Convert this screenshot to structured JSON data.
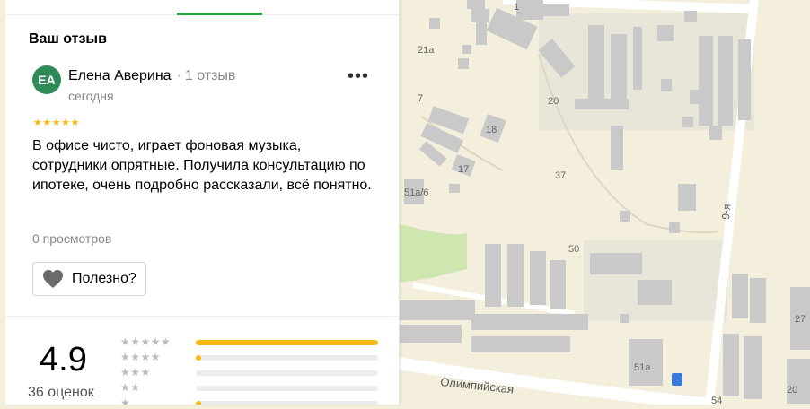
{
  "review": {
    "section_title": "Ваш отзыв",
    "avatar_initials": "ЕА",
    "author_name": "Елена Аверина",
    "separator": "·",
    "author_reviews": "1 отзыв",
    "date": "сегодня",
    "menu_label": "•••",
    "stars": "★★★★★",
    "text": "В офисе чисто, играет фоновая музыка, сотрудники опрятные. Получила консультацию по ипотеке, очень подробно рассказали, всё понятно.",
    "views": "0 просмотров",
    "useful_label": "Полезно?"
  },
  "rating": {
    "score": "4.9",
    "total": "36 оценок",
    "rows": [
      {
        "stars": "★★★★★",
        "fraction": 1.0
      },
      {
        "stars": "★★★★",
        "fraction": 0.03
      },
      {
        "stars": "★★★",
        "fraction": 0.0
      },
      {
        "stars": "★★",
        "fraction": 0.0
      },
      {
        "stars": "★",
        "fraction": 0.03
      }
    ]
  },
  "map": {
    "labels": {
      "b1": "1",
      "b21a": "21а",
      "b7": "7",
      "b18": "18",
      "b20": "20",
      "b17": "17",
      "b37": "37",
      "b51a6": "51а/6",
      "b50": "50",
      "b51a": "51а",
      "b27": "27",
      "b20b": "20",
      "b54": "54",
      "street_9": "9-я",
      "street_olymp": "Олимпийская"
    }
  },
  "colors": {
    "accent_green": "#2aa13c",
    "star_yellow": "#f6b812",
    "map_bg": "#f3efdc",
    "building": "#c9c9c9",
    "park": "#cfe6b0"
  }
}
